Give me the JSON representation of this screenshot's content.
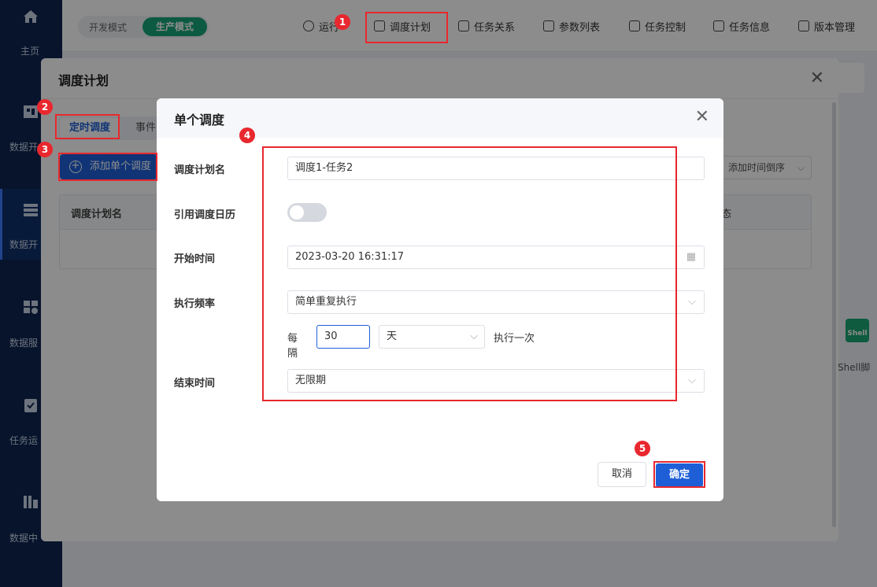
{
  "sidebar": {
    "items": [
      {
        "label": "主页",
        "icon": "home-icon"
      },
      {
        "label": "数据开",
        "icon": "data-source-icon"
      },
      {
        "label": "数据开",
        "icon": "data-dev-icon"
      },
      {
        "label": "数据服",
        "icon": "data-service-icon"
      },
      {
        "label": "任务运",
        "icon": "task-ops-icon"
      },
      {
        "label": "数据中",
        "icon": "data-center-icon"
      }
    ]
  },
  "topbar": {
    "mode_dev": "开发模式",
    "mode_prod": "生产模式",
    "nav": [
      "运行",
      "调度计划",
      "任务关系",
      "参数列表",
      "任务控制",
      "任务信息",
      "版本管理"
    ]
  },
  "background": {
    "shell_label": "Shell脚",
    "shell_badge": "Shell"
  },
  "outer_dialog": {
    "title": "调度计划",
    "tab_timed": "定时调度",
    "tab_event": "事件",
    "add_button": "添加单个调度",
    "sort_select": "添加时间倒序",
    "table_header_name": "调度计划名",
    "table_header_status": "态"
  },
  "inner_dialog": {
    "title": "单个调度",
    "labels": {
      "plan_name": "调度计划名",
      "use_calendar": "引用调度日历",
      "start_time": "开始时间",
      "frequency": "执行频率",
      "end_time": "结束时间"
    },
    "plan_name_value": "调度1-任务2",
    "start_time_value": "2023-03-20 16:31:17",
    "frequency_value": "简单重复执行",
    "every_label": "每隔",
    "interval_value": "30",
    "interval_unit": "天",
    "once_label": "执行一次",
    "end_time_value": "无限期",
    "use_calendar_on": false,
    "cancel_button": "取消",
    "ok_button": "确定"
  },
  "annotations": [
    "1",
    "2",
    "3",
    "4",
    "5"
  ],
  "colors": {
    "primary": "#1e5fd8",
    "sidebar": "#0d2550",
    "prod_green": "#17a577",
    "annotation_red": "#e8282e"
  }
}
